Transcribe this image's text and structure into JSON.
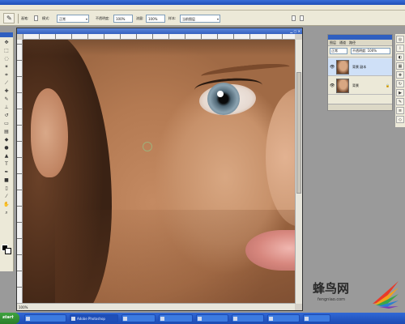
{
  "options_bar": {
    "tool_icon": "brush-icon",
    "brush_label": "画笔:",
    "mode_label": "模式:",
    "mode_value": "正常",
    "opacity_label": "不透明度:",
    "opacity_value": "100%",
    "flow_label": "流量:",
    "flow_value": "100%",
    "sample_label": "样本:",
    "sample_value": "当前图层"
  },
  "document": {
    "zoom": "100%"
  },
  "layers_panel": {
    "tabs": [
      "图层",
      "通道",
      "路径"
    ],
    "blend_mode": "正常",
    "opacity": "不透明度: 100%",
    "layers": [
      {
        "name": "背景 副本",
        "selected": true
      },
      {
        "name": "背景",
        "selected": false
      }
    ]
  },
  "watermark": {
    "name": "蜂鸟网",
    "url": "fengniao.com"
  },
  "taskbar": {
    "start_label": "start",
    "tasks": [
      "",
      "Adobe Photoshop",
      "",
      "",
      "",
      "",
      "",
      ""
    ]
  },
  "icons": {
    "eye": "eye-icon",
    "lock": "lock-icon"
  }
}
